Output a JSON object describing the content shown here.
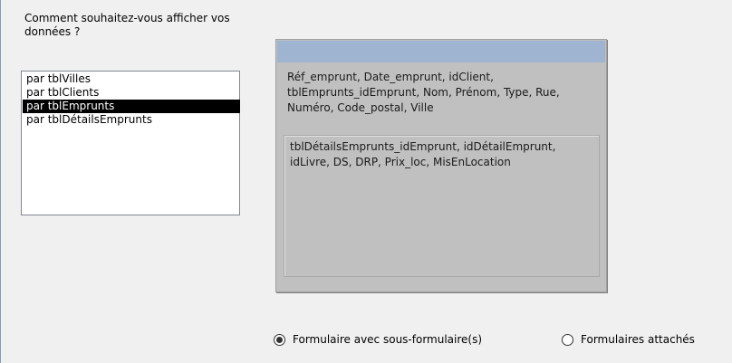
{
  "prompt": "Comment souhaitez-vous afficher vos données ?",
  "list": {
    "items": [
      {
        "label": "par tblVilles",
        "selected": false
      },
      {
        "label": "par tblClients",
        "selected": false
      },
      {
        "label": "par tblEmprunts",
        "selected": true
      },
      {
        "label": "par tblDétailsEmprunts",
        "selected": false
      }
    ]
  },
  "preview": {
    "main_fields": "Réf_emprunt, Date_emprunt, idClient, tblEmprunts_idEmprunt, Nom, Prénom, Type, Rue, Numéro, Code_postal, Ville",
    "sub_fields": "tblDétailsEmprunts_idEmprunt, idDétailEmprunt, idLivre, DS, DRP, Prix_loc, MisEnLocation"
  },
  "options": {
    "subform_label": "Formulaire avec sous-formulaire(s)",
    "subform_selected": true,
    "linked_label": "Formulaires attachés",
    "linked_selected": false
  },
  "colors": {
    "preview_header": "#9fb4d0",
    "preview_bg": "#c0c0c0",
    "selection": "#000000"
  }
}
